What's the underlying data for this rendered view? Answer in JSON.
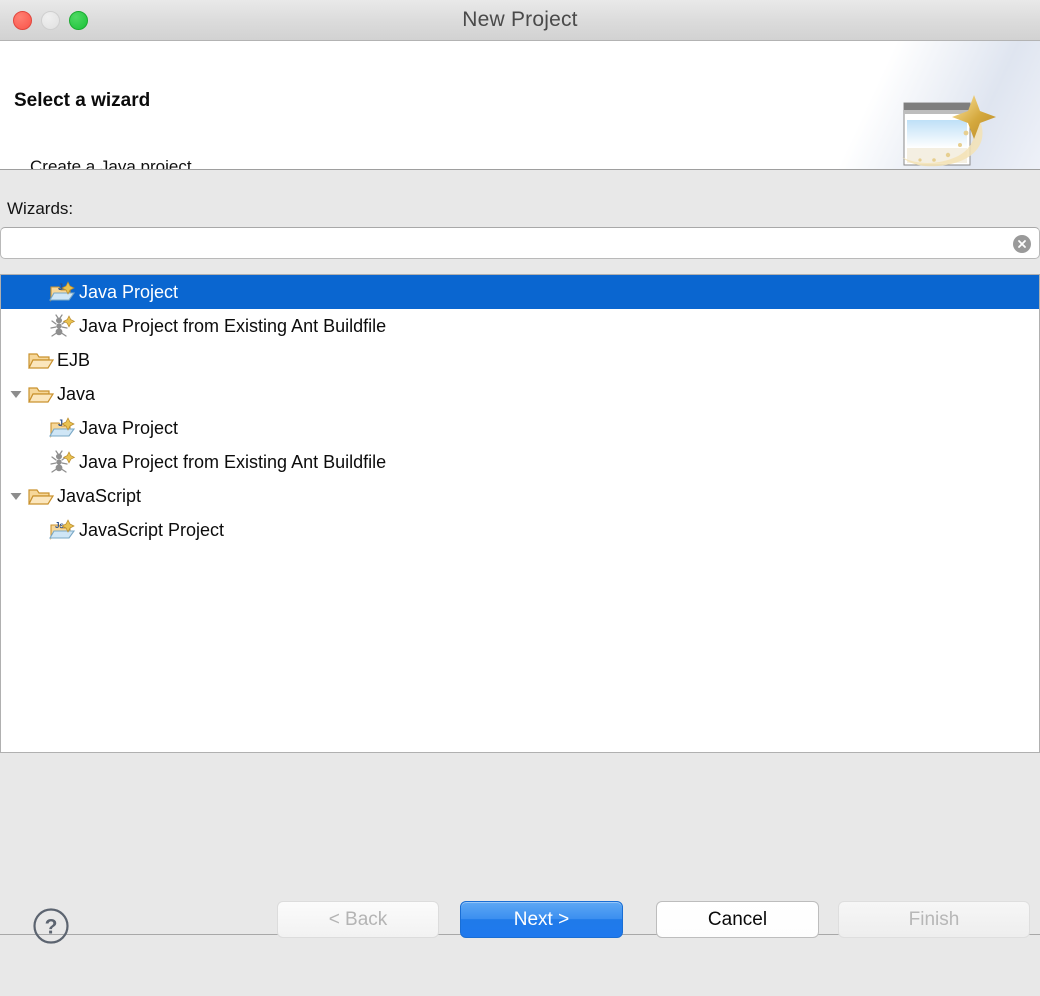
{
  "window": {
    "title": "New Project",
    "traffic_lights": [
      {
        "name": "close",
        "color": "#f9544a"
      },
      {
        "name": "minimize",
        "color": "#e0e0e0"
      },
      {
        "name": "maximize",
        "color": "#1bc238"
      }
    ]
  },
  "header": {
    "title": "Select a wizard",
    "description": "Create a Java project",
    "banner_icon": "new-project-wizard-icon"
  },
  "main": {
    "wizards_label": "Wizards:",
    "search": {
      "value": "",
      "placeholder": "",
      "clear_icon": "clear-circle-icon"
    },
    "tree": [
      {
        "label": "Java Project",
        "icon": "java-project-icon",
        "indent": 1,
        "twisty": "",
        "selected": true
      },
      {
        "label": "Java Project from Existing Ant Buildfile",
        "icon": "ant-buildfile-icon",
        "indent": 1,
        "twisty": "",
        "selected": false
      },
      {
        "label": "EJB",
        "icon": "folder-open-icon",
        "indent": 0,
        "twisty": "",
        "selected": false
      },
      {
        "label": "Java",
        "icon": "folder-open-icon",
        "indent": 0,
        "twisty": "expanded",
        "selected": false
      },
      {
        "label": "Java Project",
        "icon": "java-project-icon",
        "indent": 1,
        "twisty": "",
        "selected": false
      },
      {
        "label": "Java Project from Existing Ant Buildfile",
        "icon": "ant-buildfile-icon",
        "indent": 1,
        "twisty": "",
        "selected": false
      },
      {
        "label": "JavaScript",
        "icon": "folder-open-icon",
        "indent": 0,
        "twisty": "expanded",
        "selected": false
      },
      {
        "label": "JavaScript Project",
        "icon": "javascript-project-icon",
        "indent": 1,
        "twisty": "",
        "selected": false
      }
    ]
  },
  "footer": {
    "help_label": "?",
    "help_icon": "help-circle-icon",
    "buttons": {
      "back": {
        "label": "< Back",
        "enabled": false
      },
      "next": {
        "label": "Next >",
        "enabled": true,
        "default": true
      },
      "cancel": {
        "label": "Cancel",
        "enabled": true
      },
      "finish": {
        "label": "Finish",
        "enabled": false
      }
    }
  },
  "colors": {
    "selection_blue": "#0a66d0",
    "default_button_blue": "#1f79ee",
    "window_chrome": "#e8e8e8",
    "panel_white": "#ffffff"
  }
}
